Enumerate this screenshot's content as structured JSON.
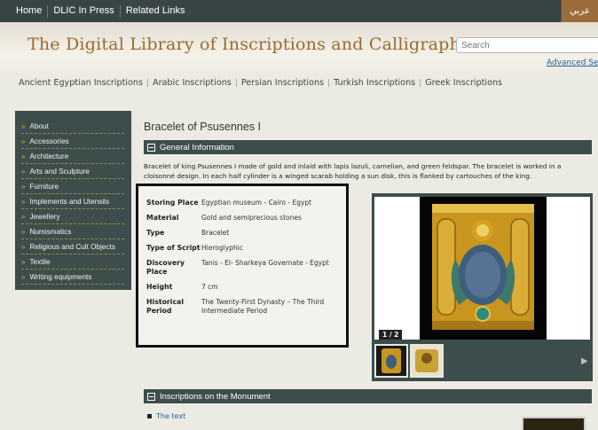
{
  "topnav": {
    "items": [
      "Home",
      "DLIC In Press",
      "Related Links"
    ],
    "language_toggle": "عربي"
  },
  "header": {
    "site_title": "The Digital Library of Inscriptions and Calligraphies",
    "search_placeholder": "Search",
    "advanced_search": "Advanced Searc"
  },
  "categories": [
    "Ancient Egyptian Inscriptions",
    "Arabic Inscriptions",
    "Persian Inscriptions",
    "Turkish Inscriptions",
    "Greek Inscriptions"
  ],
  "sidebar": {
    "items": [
      "About",
      "Accessories",
      "Architecture",
      "Arts and Sculpture",
      "Furniture",
      "Implements and Utensils",
      "Jewellery",
      "Numismatics",
      "Religious and Cult Objects",
      "Textile",
      "Writing equipments"
    ]
  },
  "main": {
    "item_title": "Bracelet of Psusennes I",
    "general_section": "General Information",
    "description": "Bracelet of king Psusennes I made of gold and inlaid with lapis lazuli, carnelian, and green feldspar. The bracelet is worked in a cloisonné design. In each half cylinder is a winged scarab holding a sun disk, this is flanked by cartouches of the king.",
    "details": [
      {
        "label": "Storing Place",
        "value": "Egyptian museum - Cairo - Egypt"
      },
      {
        "label": "Material",
        "value": "Gold and semiprecious stones"
      },
      {
        "label": "Type",
        "value": "Bracelet"
      },
      {
        "label": "Type of Script",
        "value": "Hieroglyphic"
      },
      {
        "label": "Discovery Place",
        "value": "Tanis - El- Sharkeya Governate - Egypt"
      },
      {
        "label": "Height",
        "value": "7 cm"
      },
      {
        "label": "Historical Period",
        "value": "The Twenty-First Dynasty – The Third Intermediate Period"
      }
    ],
    "gallery": {
      "counter": "1 / 2"
    },
    "inscriptions_section": "Inscriptions on the Monument",
    "inscriptions_link": "The text"
  },
  "colors": {
    "nav_bg": "#394545",
    "accent_brown": "#9b6a2f",
    "panel_bg": "#3d4d4c",
    "link_blue": "#1f5fa0"
  }
}
